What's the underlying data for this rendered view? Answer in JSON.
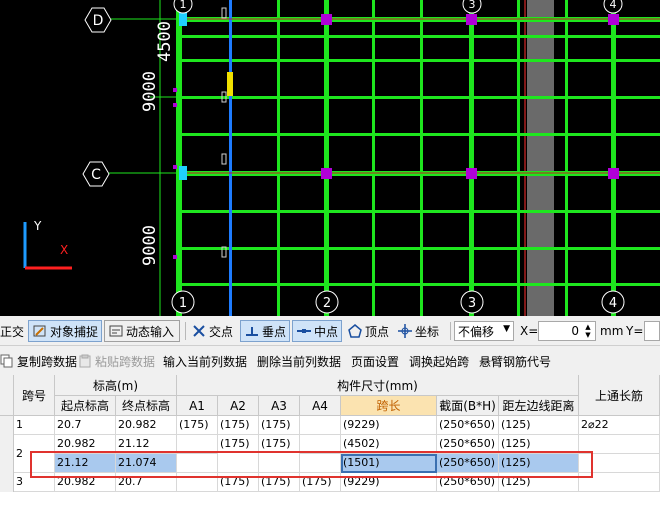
{
  "cad": {
    "axis_labels": {
      "d": "D",
      "c": "C"
    },
    "dimensions": {
      "d1": "4500",
      "d2": "9000",
      "d3": "9000"
    },
    "column_labels": [
      "1",
      "2",
      "3",
      "4"
    ],
    "ucs": {
      "y": "Y",
      "x": "X"
    },
    "colors": {
      "beam": "#1ee61e",
      "column": "#b000d8",
      "wall": "#6a6a6a",
      "blue_beam": "#1e7cff"
    }
  },
  "snapbar": {
    "ortho": "正交",
    "object_snap": "对象捕捉",
    "dynamic_input": "动态输入",
    "intersection": "交点",
    "perpendicular": "垂点",
    "midpoint": "中点",
    "vertex": "顶点",
    "coordinate": "坐标",
    "offset_mode": "不偏移",
    "x_label": "X=",
    "x_value": "0",
    "mm_label": "mm",
    "y_label": "Y="
  },
  "toolbar2": {
    "copy_span": "复制跨数据",
    "paste_span": "粘贴跨数据",
    "input_current_col": "输入当前列数据",
    "delete_current_col": "删除当前列数据",
    "page_setup": "页面设置",
    "swap_start_span": "调换起始跨",
    "cantilever_code": "悬臂钢筋代号"
  },
  "grid": {
    "headers": {
      "span_no": "跨号",
      "elevation": "标高(m)",
      "start_elev": "起点标高",
      "end_elev": "终点标高",
      "component_size": "构件尺寸(mm)",
      "a1": "A1",
      "a2": "A2",
      "a3": "A3",
      "a4": "A4",
      "span_len": "跨长",
      "section": "截面(B*H)",
      "left_dist": "距左边线距离",
      "top_rebar": "上通长筋"
    },
    "rows": [
      {
        "no": "1",
        "start": "20.7",
        "end": "20.982",
        "a1": "(175)",
        "a2": "(175)",
        "a3": "(175)",
        "a4": "",
        "span": "(9229)",
        "section": "(250*650)",
        "dist": "(125)",
        "rebar": "2⌀22"
      },
      {
        "no": "2",
        "start": "20.982",
        "end": "21.12",
        "a1": "",
        "a2": "(175)",
        "a3": "(175)",
        "a4": "",
        "span": "(4502)",
        "section": "(250*650)",
        "dist": "(125)",
        "rebar": ""
      },
      {
        "no": "",
        "start": "21.12",
        "end": "21.074",
        "a1": "",
        "a2": "",
        "a3": "",
        "a4": "",
        "span": "(1501)",
        "section": "(250*650)",
        "dist": "(125)",
        "rebar": ""
      },
      {
        "no": "3",
        "start": "20.982",
        "end": "20.7",
        "a1": "",
        "a2": "(175)",
        "a3": "(175)",
        "a4": "(175)",
        "span": "(9229)",
        "section": "(250*650)",
        "dist": "(125)",
        "rebar": ""
      }
    ]
  }
}
